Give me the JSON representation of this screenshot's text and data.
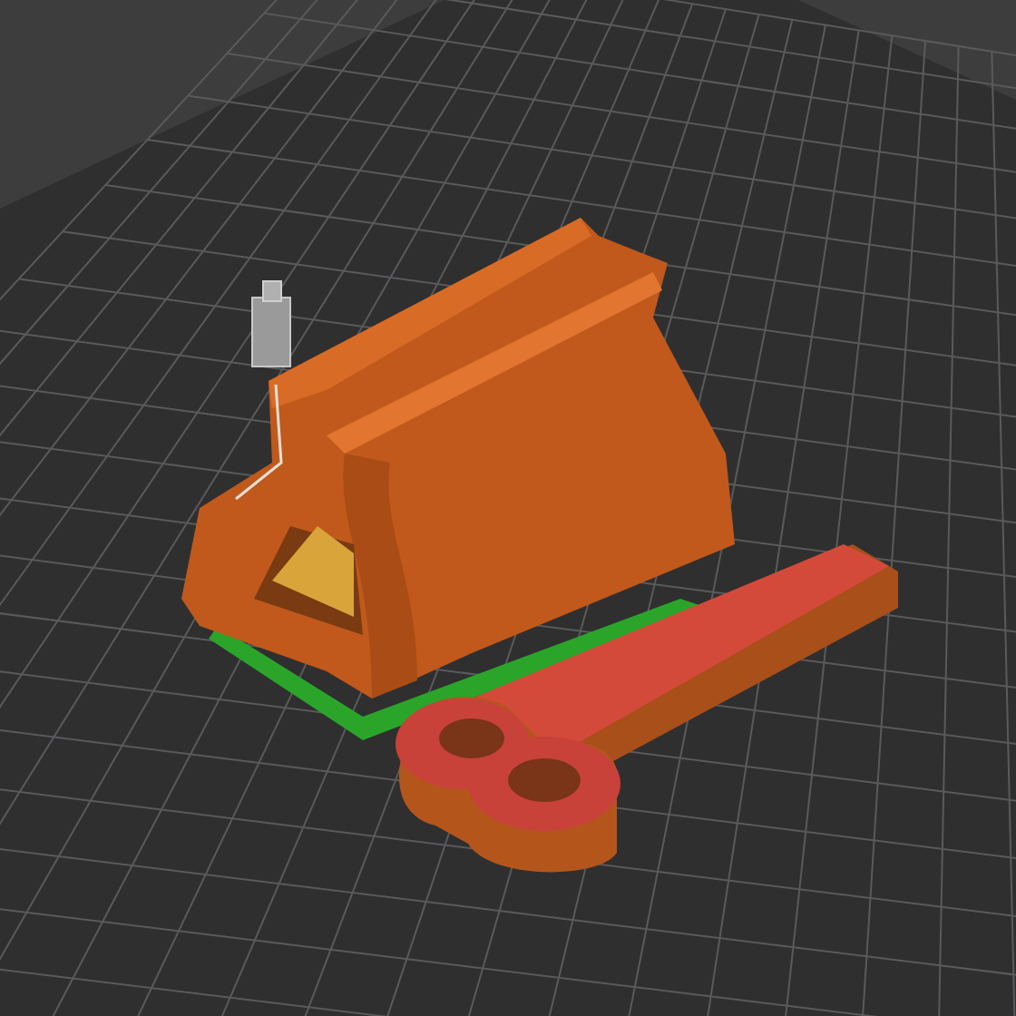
{
  "viewport": {
    "grid": true
  },
  "objects": [
    {
      "kind": "tower"
    },
    {
      "kind": "holder"
    },
    {
      "kind": "key"
    }
  ]
}
